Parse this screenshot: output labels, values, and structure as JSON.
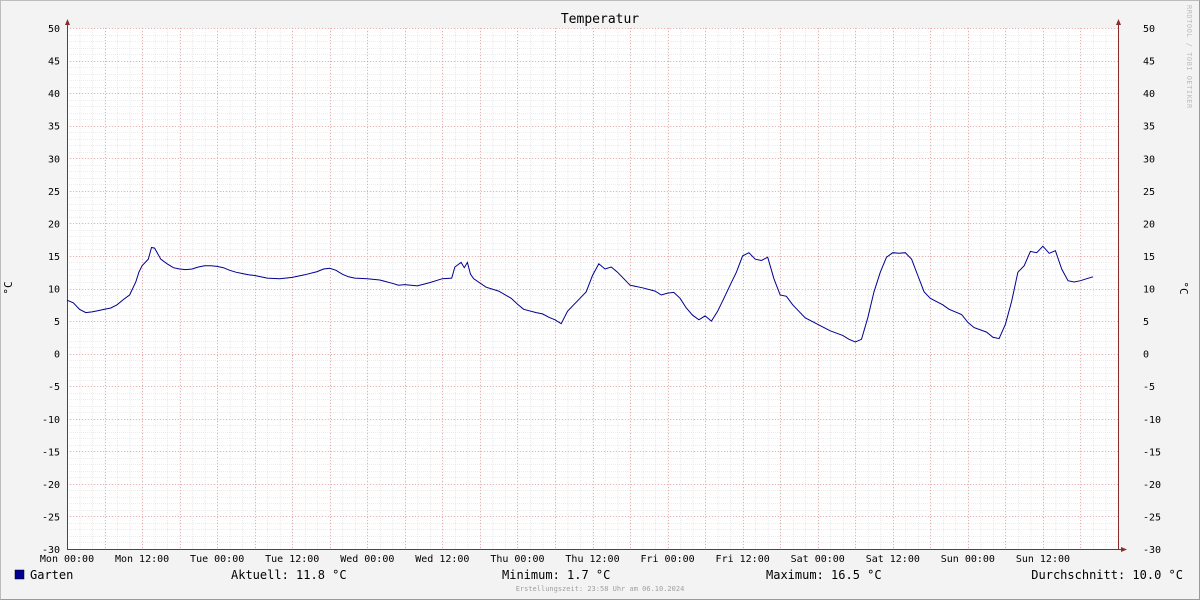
{
  "chart_data": {
    "type": "line",
    "title": "Temperatur",
    "ylabel": "°C",
    "ylabel_right": "°C",
    "ylim": [
      -30,
      50
    ],
    "y_ticks": [
      "50",
      "45",
      "40",
      "35",
      "30",
      "25",
      "20",
      "15",
      "10",
      "5",
      "0",
      "-5",
      "-10",
      "-15",
      "-20",
      "-25",
      "-30"
    ],
    "x_range_hours": [
      0,
      168
    ],
    "x_tick_labels": [
      "Mon 00:00",
      "Mon 12:00",
      "Tue 00:00",
      "Tue 12:00",
      "Wed 00:00",
      "Wed 12:00",
      "Thu 00:00",
      "Thu 12:00",
      "Fri 00:00",
      "Fri 12:00",
      "Sat 00:00",
      "Sat 12:00",
      "Sun 00:00",
      "Sun 12:00"
    ],
    "grid": true,
    "series": [
      {
        "name": "Garten",
        "color": "#000090",
        "points": [
          [
            0,
            8.2
          ],
          [
            1,
            7.8
          ],
          [
            2,
            6.8
          ],
          [
            3,
            6.3
          ],
          [
            4,
            6.4
          ],
          [
            5,
            6.6
          ],
          [
            6,
            6.8
          ],
          [
            7,
            7.0
          ],
          [
            8,
            7.5
          ],
          [
            9,
            8.3
          ],
          [
            10,
            9.0
          ],
          [
            11,
            11.0
          ],
          [
            11.5,
            12.5
          ],
          [
            12,
            13.5
          ],
          [
            13,
            14.5
          ],
          [
            13.5,
            16.3
          ],
          [
            14,
            16.2
          ],
          [
            15,
            14.5
          ],
          [
            16,
            13.8
          ],
          [
            17,
            13.2
          ],
          [
            18,
            13.0
          ],
          [
            19,
            12.9
          ],
          [
            20,
            13.0
          ],
          [
            21,
            13.3
          ],
          [
            22,
            13.5
          ],
          [
            23,
            13.5
          ],
          [
            24,
            13.4
          ],
          [
            25,
            13.2
          ],
          [
            26,
            12.8
          ],
          [
            27,
            12.5
          ],
          [
            28,
            12.3
          ],
          [
            29,
            12.1
          ],
          [
            30,
            12.0
          ],
          [
            32,
            11.6
          ],
          [
            34,
            11.5
          ],
          [
            36,
            11.7
          ],
          [
            38,
            12.1
          ],
          [
            40,
            12.6
          ],
          [
            41,
            13.0
          ],
          [
            42,
            13.1
          ],
          [
            43,
            12.8
          ],
          [
            44,
            12.2
          ],
          [
            45,
            11.8
          ],
          [
            46,
            11.6
          ],
          [
            48,
            11.5
          ],
          [
            50,
            11.3
          ],
          [
            52,
            10.8
          ],
          [
            53,
            10.5
          ],
          [
            54,
            10.6
          ],
          [
            56,
            10.4
          ],
          [
            58,
            10.9
          ],
          [
            60,
            11.5
          ],
          [
            61.5,
            11.6
          ],
          [
            62,
            13.3
          ],
          [
            63,
            14.0
          ],
          [
            63.5,
            13.2
          ],
          [
            64,
            14.0
          ],
          [
            64.5,
            12.2
          ],
          [
            65,
            11.5
          ],
          [
            67,
            10.2
          ],
          [
            69,
            9.6
          ],
          [
            71,
            8.5
          ],
          [
            72,
            7.6
          ],
          [
            73,
            6.8
          ],
          [
            75,
            6.3
          ],
          [
            76,
            6.1
          ],
          [
            77,
            5.6
          ],
          [
            78,
            5.2
          ],
          [
            79,
            4.6
          ],
          [
            80,
            6.5
          ],
          [
            81,
            7.5
          ],
          [
            82,
            8.5
          ],
          [
            83,
            9.5
          ],
          [
            84,
            12.0
          ],
          [
            85,
            13.8
          ],
          [
            86,
            13.0
          ],
          [
            87,
            13.3
          ],
          [
            88,
            12.5
          ],
          [
            89,
            11.5
          ],
          [
            90,
            10.5
          ],
          [
            92,
            10.1
          ],
          [
            94,
            9.6
          ],
          [
            95,
            9.0
          ],
          [
            96,
            9.3
          ],
          [
            97,
            9.4
          ],
          [
            98,
            8.5
          ],
          [
            99,
            7.0
          ],
          [
            100,
            5.9
          ],
          [
            101,
            5.2
          ],
          [
            102,
            5.8
          ],
          [
            103,
            5.0
          ],
          [
            104,
            6.5
          ],
          [
            105,
            8.5
          ],
          [
            106,
            10.5
          ],
          [
            107,
            12.5
          ],
          [
            108,
            15.0
          ],
          [
            109,
            15.5
          ],
          [
            110,
            14.5
          ],
          [
            111,
            14.3
          ],
          [
            112,
            14.8
          ],
          [
            113,
            11.5
          ],
          [
            114,
            9.0
          ],
          [
            115,
            8.8
          ],
          [
            116,
            7.5
          ],
          [
            117,
            6.5
          ],
          [
            118,
            5.5
          ],
          [
            120,
            4.5
          ],
          [
            122,
            3.5
          ],
          [
            124,
            2.8
          ],
          [
            125,
            2.2
          ],
          [
            126,
            1.8
          ],
          [
            127,
            2.2
          ],
          [
            128,
            5.5
          ],
          [
            129,
            9.5
          ],
          [
            130,
            12.5
          ],
          [
            131,
            14.8
          ],
          [
            132,
            15.5
          ],
          [
            133,
            15.4
          ],
          [
            134,
            15.5
          ],
          [
            135,
            14.5
          ],
          [
            136,
            12.0
          ],
          [
            137,
            9.5
          ],
          [
            138,
            8.5
          ],
          [
            140,
            7.5
          ],
          [
            141,
            6.8
          ],
          [
            143,
            6.0
          ],
          [
            144,
            4.8
          ],
          [
            145,
            4.0
          ],
          [
            147,
            3.3
          ],
          [
            148,
            2.5
          ],
          [
            149,
            2.3
          ],
          [
            150,
            4.5
          ],
          [
            151,
            8.0
          ],
          [
            152,
            12.5
          ],
          [
            153,
            13.5
          ],
          [
            154,
            15.7
          ],
          [
            155,
            15.5
          ],
          [
            156,
            16.5
          ],
          [
            157,
            15.4
          ],
          [
            158,
            15.8
          ],
          [
            159,
            13.0
          ],
          [
            160,
            11.2
          ],
          [
            161,
            11.0
          ],
          [
            162,
            11.2
          ],
          [
            163,
            11.5
          ],
          [
            164,
            11.8
          ]
        ]
      }
    ],
    "watermark": "RRDTOOL / TOBI OETIKER"
  },
  "legend": {
    "series_name": "Garten",
    "swatch_color": "#000090",
    "current": "Aktuell: 11.8 °C",
    "minimum": "Minimum: 1.7 °C",
    "maximum": "Maximum: 16.5 °C",
    "average": "Durchschnitt: 10.0 °C"
  },
  "footer": "Erstellungszeit: 23:58 Uhr am 06.10.2024",
  "colors": {
    "background": "#f3f3f3",
    "plot_background": "#ffffff",
    "major_grid": "#e8a0a0",
    "minor_grid": "#dcdcdc",
    "axis": "#8b2c2c",
    "line": "#000090"
  }
}
